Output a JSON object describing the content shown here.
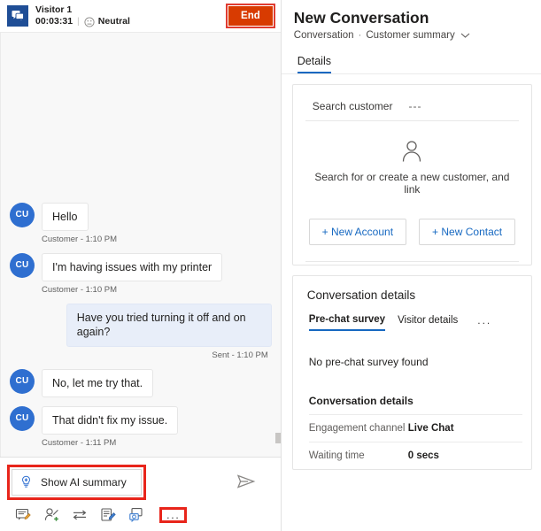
{
  "chat": {
    "header": {
      "visitor_icon": "chat-bubble-icon",
      "visitor_name": "Visitor 1",
      "duration": "00:03:31",
      "sentiment_icon": "neutral-face-icon",
      "sentiment_label": "Neutral",
      "end_label": "End",
      "end_color": "#d83b01",
      "highlight_color": "#e8251b"
    },
    "messages": [
      {
        "direction": "in",
        "avatar": "CU",
        "text": "Hello",
        "meta": "Customer - 1:10 PM"
      },
      {
        "direction": "in",
        "avatar": "CU",
        "text": "I'm having issues with my printer",
        "meta": "Customer - 1:10 PM"
      },
      {
        "direction": "out",
        "text": "Have you tried turning it off and on again?",
        "meta": "Sent - 1:10 PM"
      },
      {
        "direction": "in",
        "avatar": "CU",
        "text": "No, let me try that.",
        "meta": ""
      },
      {
        "direction": "in",
        "avatar": "CU",
        "text": "That didn't fix my issue.",
        "meta": "Customer - 1:11 PM"
      }
    ],
    "composer": {
      "ai_summary_label": "Show AI summary",
      "ai_summary_icon": "lightbulb-icon",
      "send_icon": "send-paper-plane-icon",
      "tools": [
        "note-icon",
        "assign-user-icon",
        "transfer-icon",
        "quick-reply-icon",
        "knowledge-article-icon"
      ],
      "more_label": "...",
      "avatar_color": "#2f6fd0",
      "agent_bubble_color": "#e8eef9"
    }
  },
  "details": {
    "title": "New Conversation",
    "breadcrumb": {
      "parent": "Conversation",
      "current": "Customer summary",
      "chevron": "chevron-down-icon"
    },
    "tabs": [
      {
        "label": "Details",
        "active": true
      }
    ],
    "customer_card": {
      "search_label": "Search customer",
      "search_value": "---",
      "person_icon": "person-outline-icon",
      "empty_text": "Search for or create a new customer, and link",
      "buttons": [
        "+ New Account",
        "+ New Contact"
      ]
    },
    "conversation_card": {
      "title": "Conversation details",
      "tabs": [
        {
          "label": "Pre-chat survey",
          "active": true
        },
        {
          "label": "Visitor details",
          "active": false
        }
      ],
      "more_label": "...",
      "empty_text": "No pre-chat survey found",
      "section_title": "Conversation details",
      "fields": [
        {
          "key": "Engagement channel",
          "value": "Live Chat"
        },
        {
          "key": "Waiting time",
          "value": "0 secs"
        }
      ]
    },
    "accent_color": "#1668c1"
  }
}
